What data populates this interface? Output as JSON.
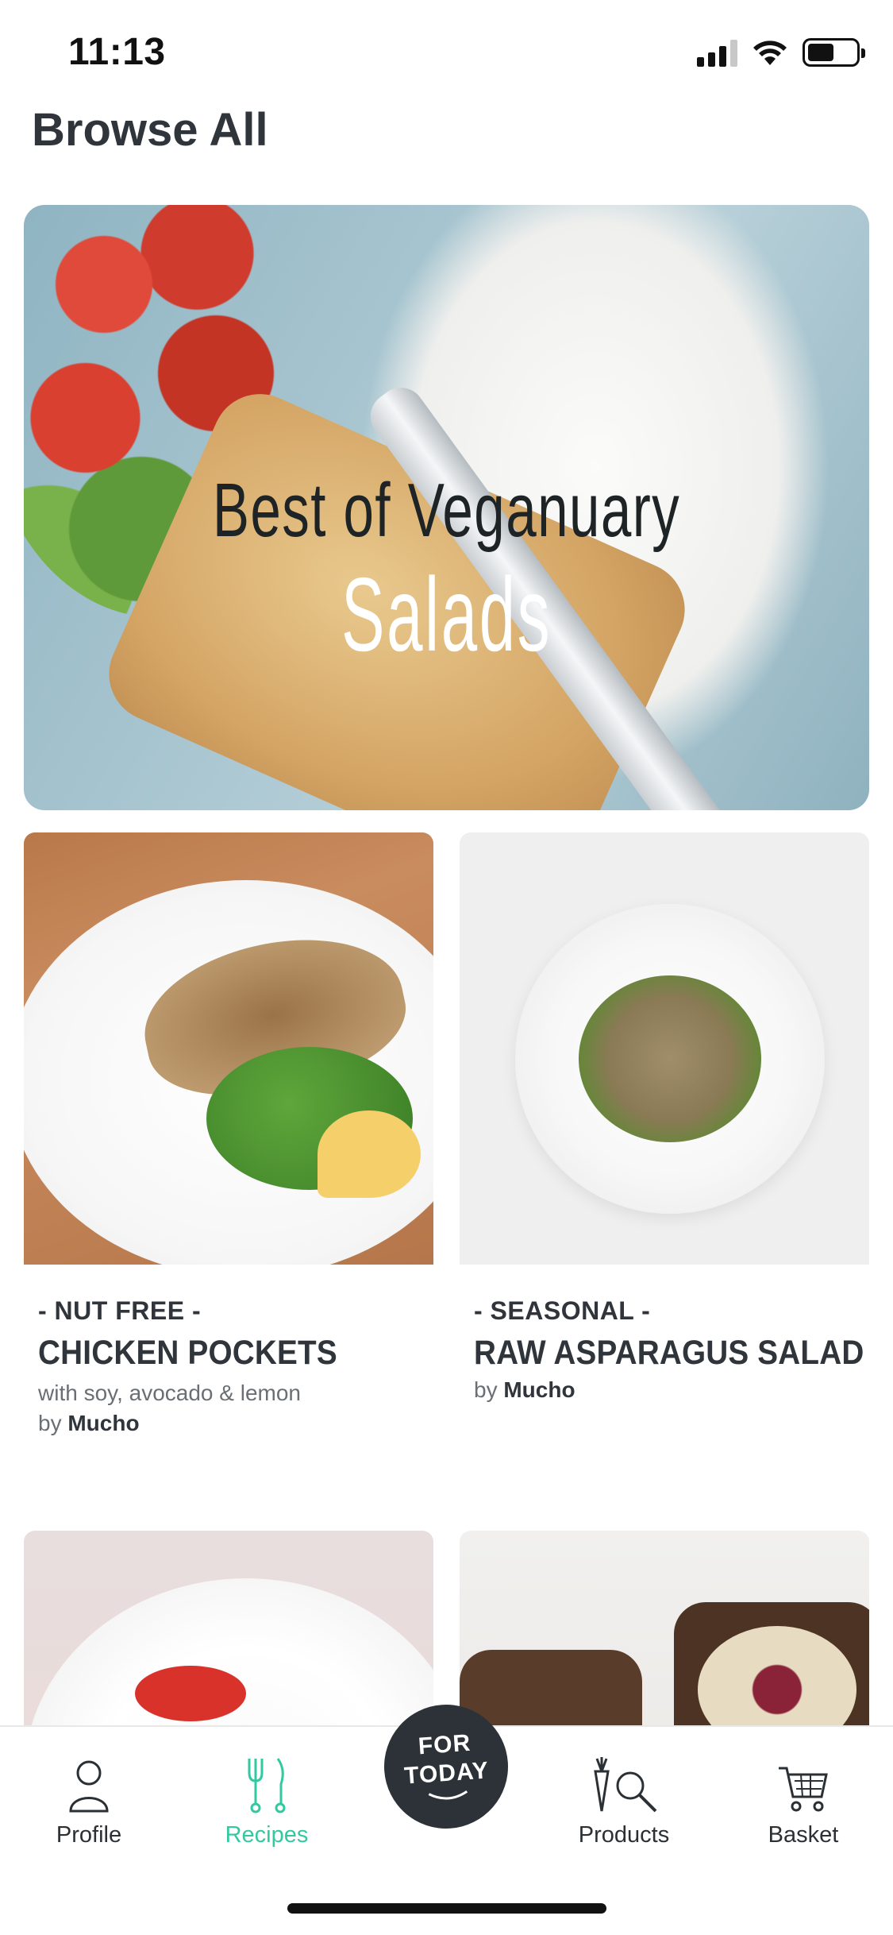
{
  "status_bar": {
    "time": "11:13"
  },
  "header": {
    "title": "Browse All"
  },
  "hero": {
    "line1": "Best of Veganuary",
    "line2": "Salads"
  },
  "cards": [
    {
      "tag": "- NUT FREE -",
      "name": "CHICKEN POCKETS",
      "description": "with soy, avocado & lemon",
      "by_prefix": "by",
      "author": "Mucho"
    },
    {
      "tag": "- SEASONAL -",
      "name": "RAW ASPARAGUS SALAD",
      "description": "",
      "by_prefix": "by",
      "author": "Mucho"
    }
  ],
  "tabbar": {
    "items": [
      {
        "label": "Profile",
        "icon": "person-icon",
        "active": false
      },
      {
        "label": "Recipes",
        "icon": "fork-knife-icon",
        "active": true
      },
      {
        "label": "Products",
        "icon": "carrot-search-icon",
        "active": false
      },
      {
        "label": "Basket",
        "icon": "cart-icon",
        "active": false
      }
    ],
    "center_button": {
      "line1": "FOR",
      "line2": "TODAY"
    },
    "active_color": "#33c9a0",
    "fab_color": "#2c3237"
  }
}
